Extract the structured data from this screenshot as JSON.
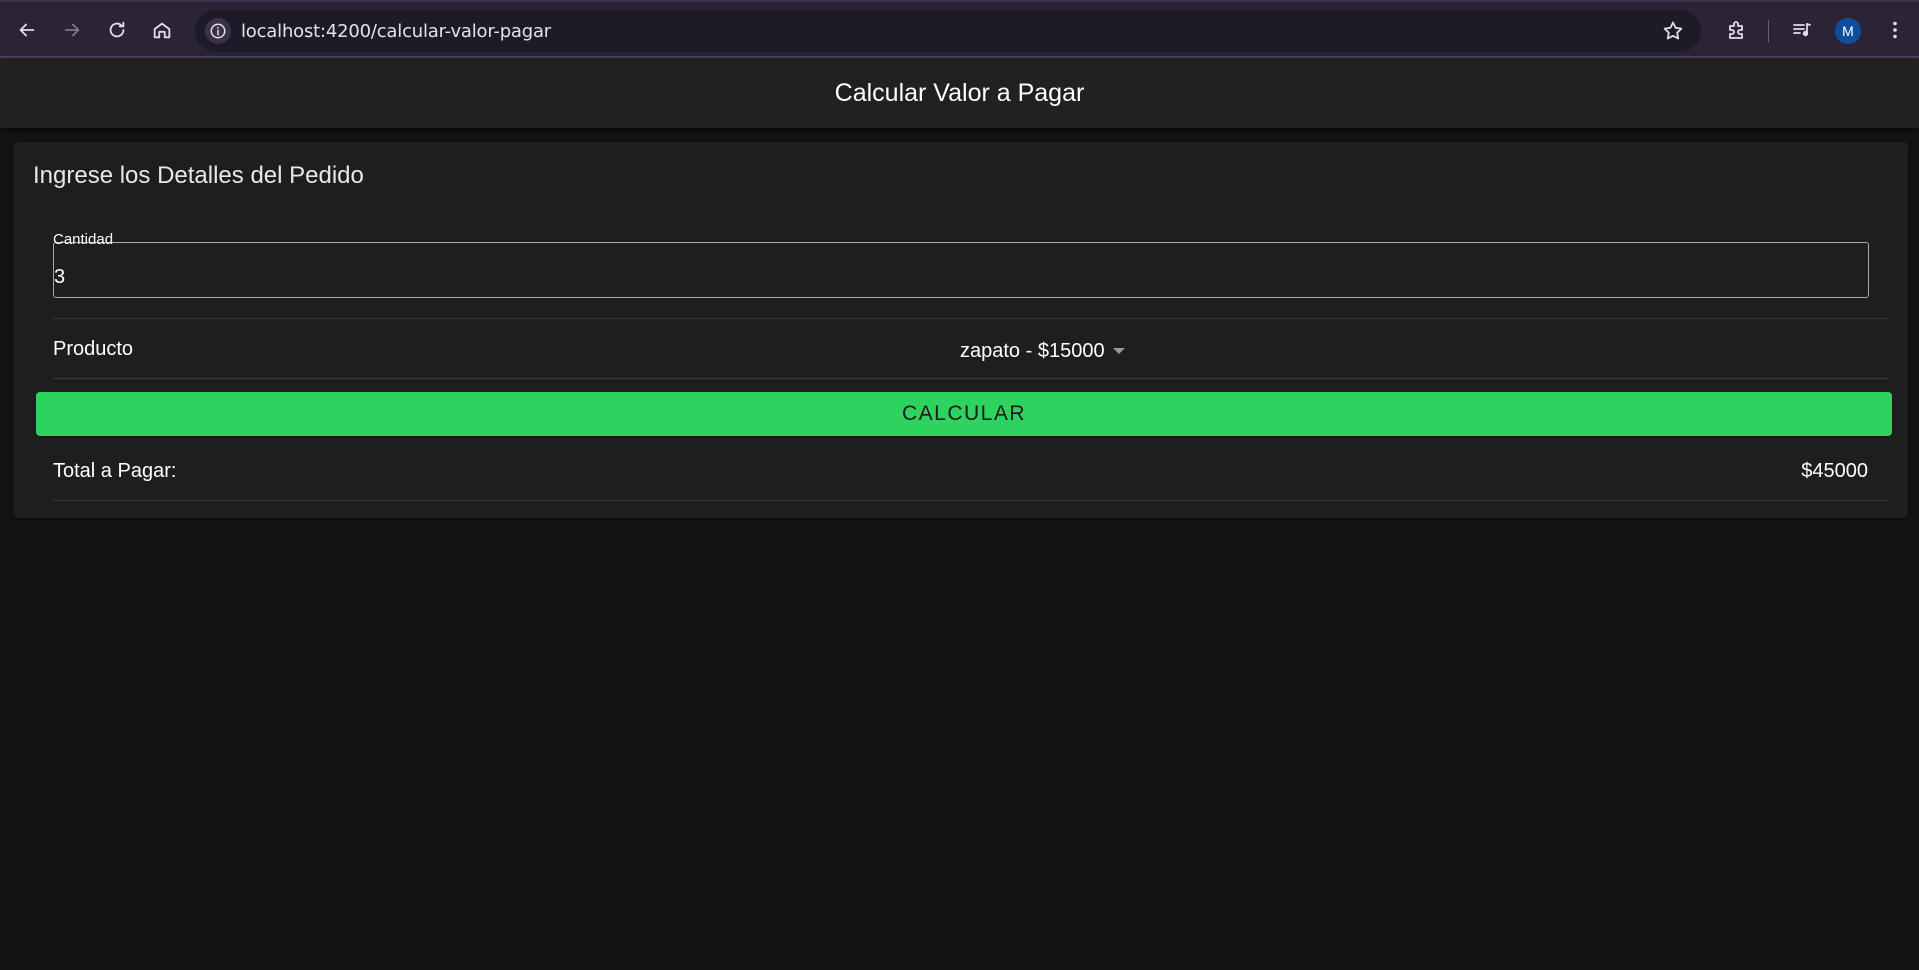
{
  "browser": {
    "url": "localhost:4200/calcular-valor-pagar",
    "profile_initial": "M",
    "icons": {
      "back": "arrow-left-icon",
      "forward": "arrow-right-icon",
      "reload": "reload-icon",
      "home": "home-icon",
      "site_info": "info-icon",
      "bookmark": "star-icon",
      "extensions": "puzzle-icon",
      "media": "media-queue-icon",
      "menu": "kebab-menu-icon"
    }
  },
  "header": {
    "title": "Calcular Valor a Pagar"
  },
  "form": {
    "title": "Ingrese los Detalles del Pedido",
    "quantity": {
      "label": "Cantidad",
      "value": "3"
    },
    "product": {
      "label": "Producto",
      "selected": "zapato - $15000"
    },
    "submit_label": "CALCULAR",
    "total": {
      "label": "Total a Pagar:",
      "value": "$45000"
    }
  },
  "colors": {
    "accent": "#2dd35e",
    "background": "#131313",
    "card": "#1e1e1e",
    "header": "#212121",
    "browser_frame": "#2b2336"
  }
}
